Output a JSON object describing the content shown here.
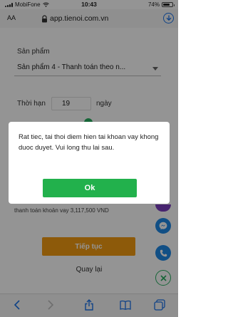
{
  "status_bar": {
    "carrier": "MobiFone",
    "time": "10:43",
    "battery": "74%",
    "battery_level": 0.74
  },
  "address_bar": {
    "text_size_label": "AA",
    "url": "app.tienoi.com.vn",
    "icons": [
      "lock-icon",
      "download-icon"
    ]
  },
  "form": {
    "product_label": "Sản phẩm",
    "product_value": "Sản phẩm 4 - Thanh toán theo n...",
    "term_label": "Thời hạn",
    "term_value": "19",
    "term_unit": "ngày",
    "summary_text": "thanh toán khoản vay 3,117,500 VND",
    "continue_label": "Tiếp tục",
    "back_label": "Quay lại"
  },
  "floating_buttons": [
    "messenger-icon",
    "phone-icon",
    "close-icon"
  ],
  "modal": {
    "message": "Rat tiec, tai thoi diem hien tai khoan vay khong duoc duyet. Vui long thu lai sau.",
    "ok_label": "Ok"
  },
  "toolbar": {
    "icons": [
      "back-icon",
      "forward-icon",
      "share-icon",
      "bookmarks-icon",
      "tabs-icon"
    ]
  },
  "colors": {
    "ok_green": "#22b14c",
    "continue_orange": "#f39c12",
    "link_blue": "#1a73e8",
    "fab_blue": "#1e88e5"
  }
}
